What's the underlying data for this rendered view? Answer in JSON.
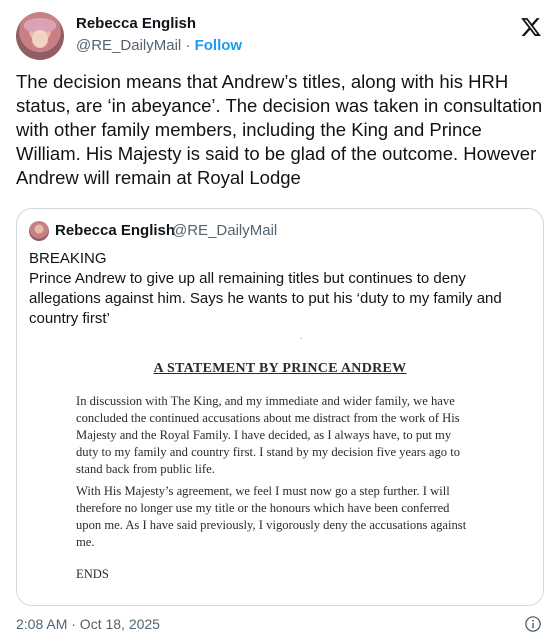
{
  "author": {
    "name": "Rebecca English",
    "handle": "@RE_DailyMail",
    "separator": "·",
    "follow_label": "Follow"
  },
  "tweet": {
    "text": "The decision means that Andrew’s titles, along with his HRH status, are ‘in abeyance’. The decision was taken in consultation with other family members, including the King and Prince William. His Majesty is said to be glad of the outcome. However Andrew will remain at Royal Lodge"
  },
  "quote": {
    "name": "Rebecca English",
    "handle": "@RE_DailyMail",
    "line1": "BREAKING",
    "line2": "Prince Andrew to give up all remaining titles but continues to deny allegations against him. Says he wants to put his ‘duty to my family and country first’",
    "statement": {
      "title": "A STATEMENT BY PRINCE ANDREW",
      "paragraph1": "In discussion with The King, and my immediate and wider family, we have concluded the continued accusations about me distract from the work of His Majesty and the Royal Family. I have decided, as I always have, to put my duty to my family and country first. I stand by my decision five years ago to stand back from public life.",
      "paragraph2": "With His Majesty’s agreement, we feel I must now go a step further. I will therefore no longer use my title or the honours which have been conferred upon me. As I have said previously, I vigorously deny the accusations against me.",
      "ends": "ENDS"
    }
  },
  "footer": {
    "timestamp": "2:08 AM · Oct 18, 2025"
  },
  "icons": {
    "brand": "x-logo-icon",
    "info": "info-icon"
  },
  "colors": {
    "accent": "#1d9bf0",
    "text": "#0f1419",
    "muted": "#536471",
    "border": "#cfd9de"
  }
}
